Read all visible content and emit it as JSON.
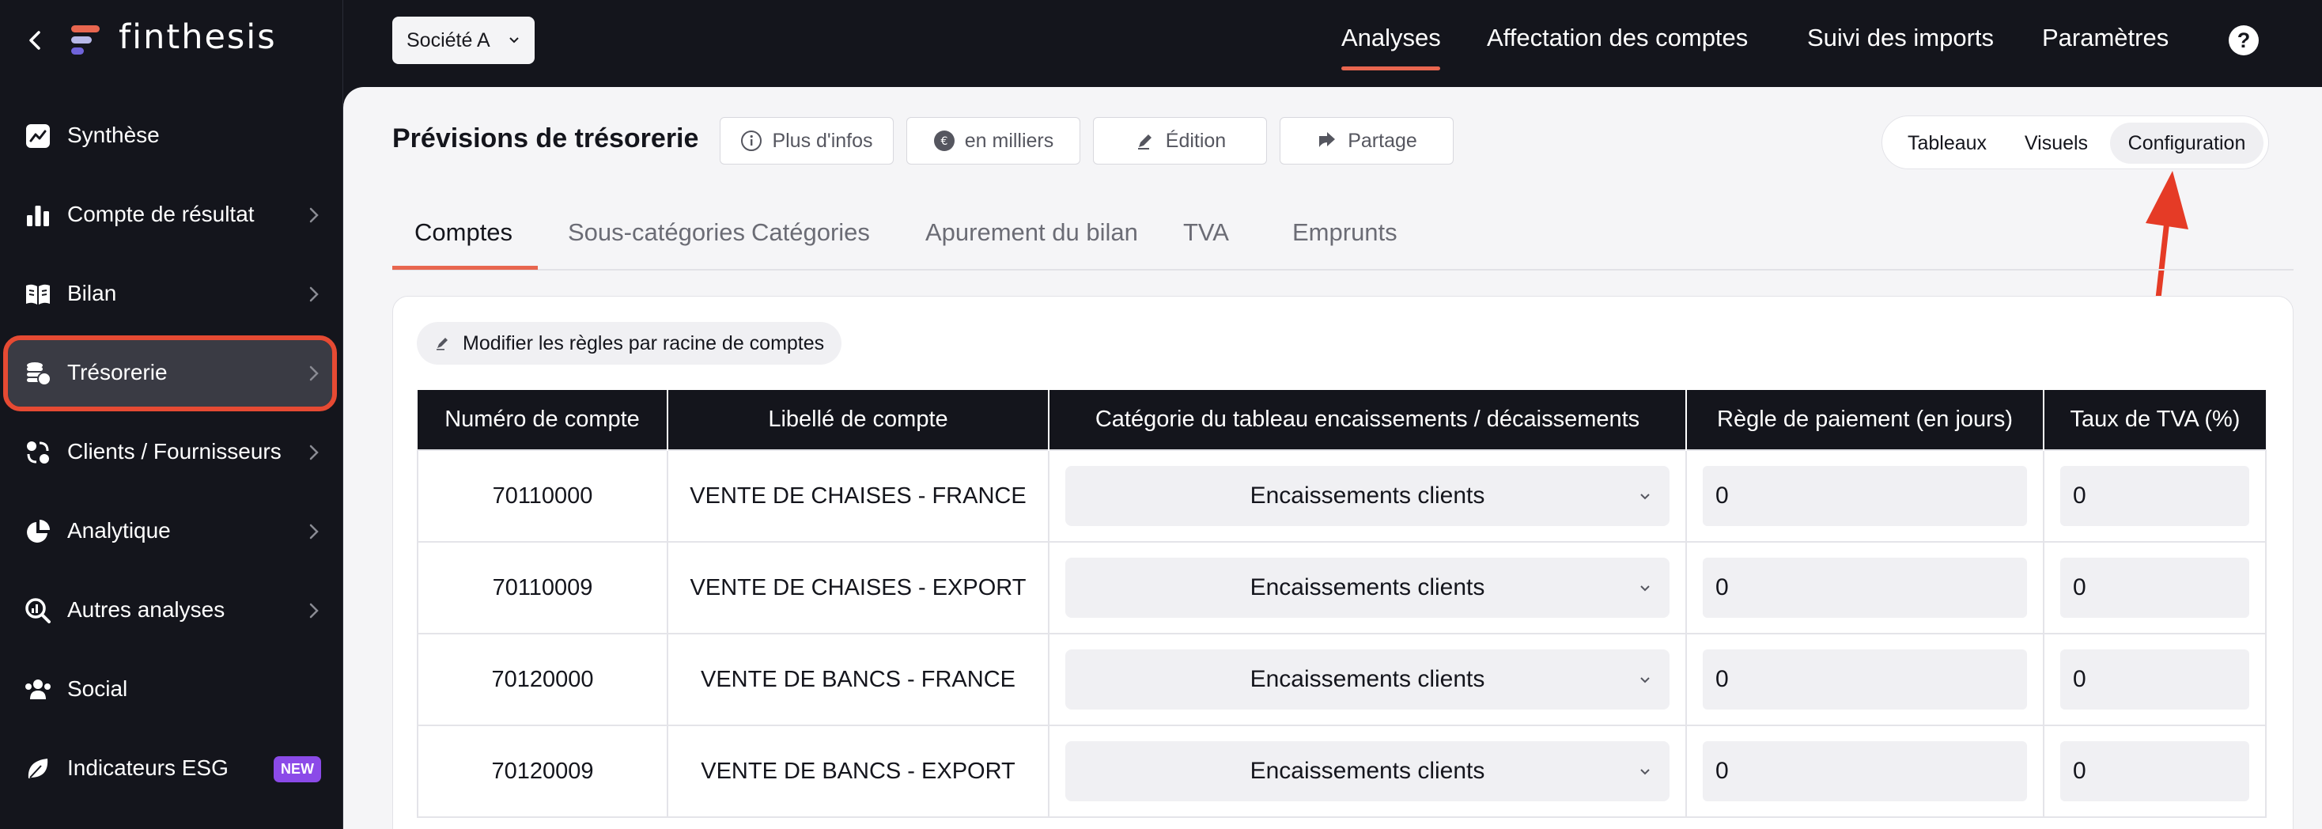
{
  "brand": {
    "name": "finthesis",
    "accent": "#e8664f"
  },
  "sidebar": {
    "items": [
      {
        "label": "Synthèse",
        "icon": "trend-chart-icon",
        "chevron": false
      },
      {
        "label": "Compte de résultat",
        "icon": "bar-chart-icon",
        "chevron": true
      },
      {
        "label": "Bilan",
        "icon": "book-icon",
        "chevron": true
      },
      {
        "label": "Trésorerie",
        "icon": "coins-icon",
        "chevron": true,
        "active": true
      },
      {
        "label": "Clients / Fournisseurs",
        "icon": "exchange-icon",
        "chevron": true
      },
      {
        "label": "Analytique",
        "icon": "pie-chart-icon",
        "chevron": true
      },
      {
        "label": "Autres analyses",
        "icon": "magnify-chart-icon",
        "chevron": true
      },
      {
        "label": "Social",
        "icon": "users-icon",
        "chevron": false
      },
      {
        "label": "Indicateurs ESG",
        "icon": "leaf-icon",
        "chevron": false,
        "badge": "NEW"
      }
    ]
  },
  "topbar": {
    "company": "Société A",
    "nav": [
      "Analyses",
      "Affectation des comptes",
      "Suivi des imports",
      "Paramètres"
    ],
    "active_nav": "Analyses",
    "help": "?"
  },
  "page": {
    "title": "Prévisions de trésorerie",
    "toolbar": {
      "info": "Plus d'infos",
      "units": "en milliers",
      "edit": "Édition",
      "share": "Partage"
    },
    "views": [
      "Tableaux",
      "Visuels",
      "Configuration"
    ],
    "active_view": "Configuration",
    "tabs": [
      "Comptes",
      "Sous-catégories",
      "Catégories",
      "Apurement du bilan",
      "TVA",
      "Emprunts"
    ],
    "active_tab": "Comptes"
  },
  "config": {
    "rules_button": "Modifier les règles par racine de comptes",
    "columns": [
      "Numéro de compte",
      "Libellé de compte",
      "Catégorie du tableau encaissements / décaissements",
      "Règle de paiement (en jours)",
      "Taux de TVA (%)"
    ],
    "rows": [
      {
        "account": "70110000",
        "label": "VENTE DE CHAISES - FRANCE",
        "category": "Encaissements clients",
        "payment_days": "0",
        "vat": "0"
      },
      {
        "account": "70110009",
        "label": "VENTE DE CHAISES - EXPORT",
        "category": "Encaissements clients",
        "payment_days": "0",
        "vat": "0"
      },
      {
        "account": "70120000",
        "label": "VENTE DE BANCS - FRANCE",
        "category": "Encaissements clients",
        "payment_days": "0",
        "vat": "0"
      },
      {
        "account": "70120009",
        "label": "VENTE DE BANCS - EXPORT",
        "category": "Encaissements clients",
        "payment_days": "0",
        "vat": "0"
      }
    ]
  }
}
